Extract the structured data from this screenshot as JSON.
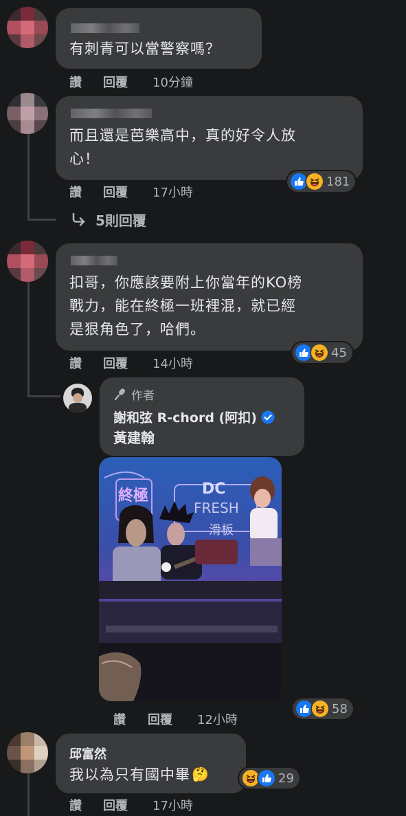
{
  "actions": {
    "like": "讚",
    "reply": "回覆"
  },
  "comments": [
    {
      "text": "有刺青可以當警察嗎？",
      "time": "10分鐘"
    },
    {
      "text_lines": [
        "而且還是芭樂高中，真的好令人放",
        "心！"
      ],
      "time": "17小時",
      "reactions": "181"
    },
    {
      "view_replies": "5則回覆"
    },
    {
      "text_lines": [
        "扣哥，你應該要附上你當年的KO榜",
        "戰力，能在終極一班裡混，就已經",
        "是狠角色了，哈們。"
      ],
      "time": "14小時",
      "reactions": "45"
    },
    {
      "author_badge": "作者",
      "author": "謝和弦 R-chord (阿扣)",
      "text": "黃建翰",
      "photo_board_text": [
        "終極",
        "DC",
        "FRESH",
        "滑板"
      ],
      "time": "12小時",
      "reactions": "58"
    },
    {
      "author": "邱富然",
      "text": "我以為只有國中畢",
      "emoji": "🤔",
      "time": "17小時",
      "reactions": "29"
    }
  ],
  "colors": {
    "background": "#18191a",
    "bubble": "#3a3b3c",
    "like_blue": "#1877f2",
    "haha_yellow": "#f7b125",
    "verified_blue": "#1877f2"
  }
}
